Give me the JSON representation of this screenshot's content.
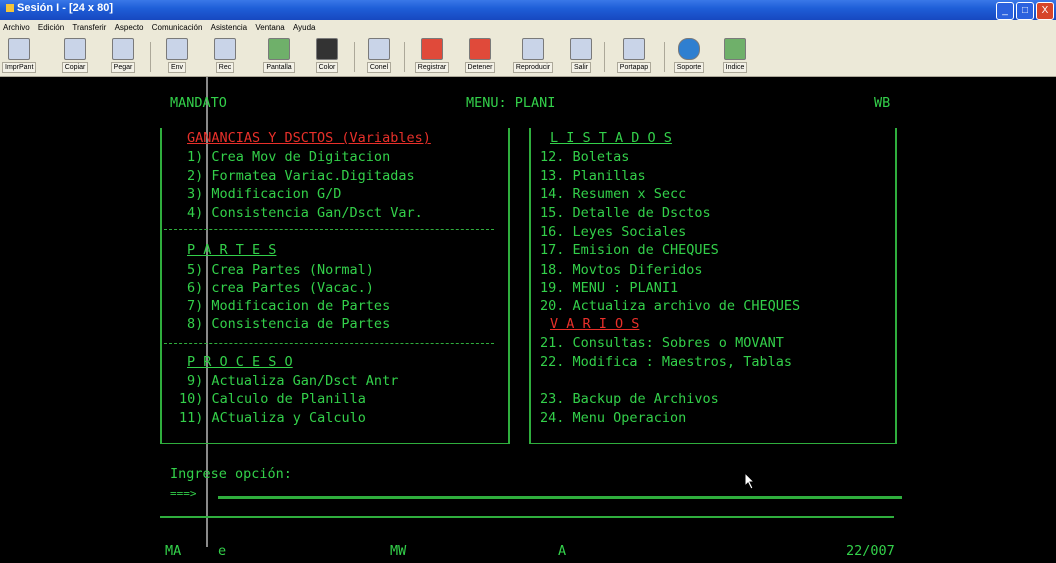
{
  "window": {
    "title": "Sesión I - [24 x 80]",
    "buttons": [
      "_",
      "□",
      "X"
    ]
  },
  "menubar": [
    "Archivo",
    "Edición",
    "Transferir",
    "Aspecto",
    "Comunicación",
    "Asistencia",
    "Ventana",
    "Ayuda"
  ],
  "toolbar": [
    {
      "label": "ImprPant",
      "icon": "printer-icon"
    },
    {
      "label": "Copiar",
      "icon": "copy-icon"
    },
    {
      "label": "Pegar",
      "icon": "paste-icon"
    },
    {
      "label": "Env",
      "icon": "send-icon"
    },
    {
      "label": "Rec",
      "icon": "receive-icon"
    },
    {
      "label": "Pantalla",
      "icon": "screen-icon"
    },
    {
      "label": "Color",
      "icon": "color-icon"
    },
    {
      "label": "Conel",
      "icon": "connect-icon"
    },
    {
      "label": "Registrar",
      "icon": "record-icon"
    },
    {
      "label": "Detener",
      "icon": "stop-icon"
    },
    {
      "label": "Reproducir",
      "icon": "play-icon"
    },
    {
      "label": "Salir",
      "icon": "exit-icon"
    },
    {
      "label": "Portapap",
      "icon": "clipboard-icon"
    },
    {
      "label": "Soporte",
      "icon": "globe-icon"
    },
    {
      "label": "Indice",
      "icon": "index-icon"
    }
  ],
  "terminal": {
    "header": {
      "left": "MANDATO",
      "center": "MENU: PLANI",
      "right": "WB"
    },
    "left": {
      "ganancias_title": "GANANCIAS Y DSCTOS (Variables)",
      "ganancias_items": [
        "1) Crea Mov de Digitacion",
        "2) Formatea Variac.Digitadas",
        "3) Modificacion G/D",
        "4) Consistencia Gan/Dsct Var."
      ],
      "partes_title": "P A R T E S",
      "partes_items": [
        "5) Crea Partes (Normal)",
        "6) crea Partes (Vacac.)",
        "7) Modificacion de Partes",
        "8) Consistencia de Partes"
      ],
      "proceso_title": "P R O C E S O",
      "proceso_items": [
        "9) Actualiza Gan/Dsct Antr",
        "10) Calculo de Planilla",
        "11) ACtualiza y Calculo"
      ]
    },
    "right": {
      "listados_title": "L I S T A D O S",
      "listados_items": [
        "12. Boletas",
        "13. Planillas",
        "14. Resumen x Secc",
        "15. Detalle de Dsctos",
        "16. Leyes Sociales",
        "17. Emision de CHEQUES",
        "18. Movtos Diferidos",
        "19. MENU : PLANI1",
        "20. Actualiza archivo de CHEQUES"
      ],
      "varios_title": "V A R I O S",
      "varios_items": [
        "21. Consultas: Sobres o MOVANT",
        "22. Modifica : Maestros, Tablas"
      ],
      "extra_items": [
        "23. Backup de Archivos",
        "24. Menu Operacion"
      ]
    },
    "prompt": {
      "label": "Ingrese opción:",
      "arrow": "===>"
    },
    "status": {
      "s1": "MA",
      "s2": "e",
      "s3": "MW",
      "s4": "A",
      "pos": "22/007"
    }
  }
}
